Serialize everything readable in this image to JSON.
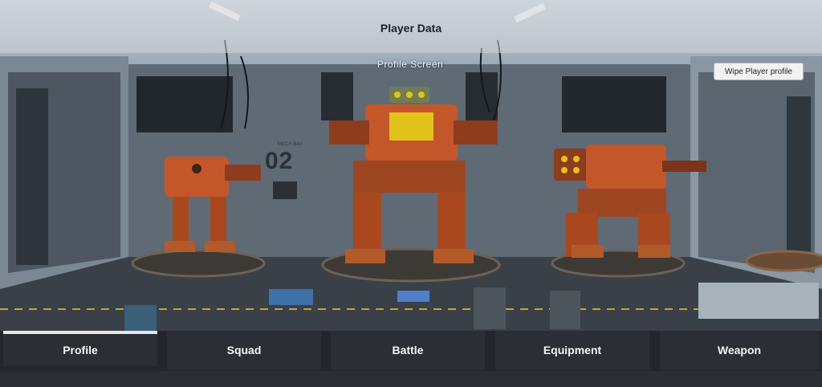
{
  "header": {
    "title": "Player Data"
  },
  "scene": {
    "screen_label": "Profile Screen",
    "hangar_number": "02",
    "hangar_small_label": "MECH BAY"
  },
  "actions": {
    "wipe_profile_label": "Wipe Player profile"
  },
  "nav": {
    "tabs": [
      {
        "label": "Profile",
        "active": true
      },
      {
        "label": "Squad",
        "active": false
      },
      {
        "label": "Battle",
        "active": false
      },
      {
        "label": "Equipment",
        "active": false
      },
      {
        "label": "Weapon",
        "active": false
      }
    ]
  },
  "colors": {
    "mech_orange": "#c4572a",
    "mech_yellow": "#e3c21c",
    "nav_bg": "#2b2f35",
    "header_bg": "#d2d6da"
  }
}
